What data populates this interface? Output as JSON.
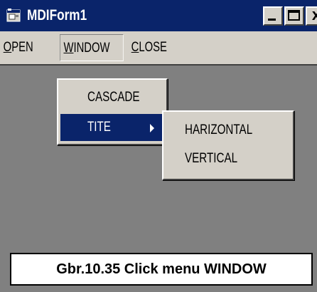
{
  "window": {
    "title": "MDIForm1",
    "icon": "app-form-icon",
    "buttons": {
      "minimize_icon": "minimize-icon",
      "maximize_icon": "maximize-icon",
      "close_label": "x"
    }
  },
  "menubar": {
    "items": [
      {
        "label_underlined": "O",
        "label_rest": "PEN"
      },
      {
        "label_underlined": "W",
        "label_rest": "INDOW"
      },
      {
        "label_underlined": "C",
        "label_rest": "LOSE"
      }
    ]
  },
  "window_menu": {
    "items": [
      {
        "label": "CASCADE",
        "selected": false
      },
      {
        "label": "TITE",
        "selected": true,
        "has_submenu": true
      }
    ]
  },
  "tite_submenu": {
    "items": [
      {
        "label": "HARIZONTAL"
      },
      {
        "label": "VERTICAL"
      }
    ]
  },
  "caption": {
    "text": "Gbr.10.35  Click menu WINDOW"
  },
  "colors": {
    "titlebar": "#0a246a",
    "face": "#d4d0c8",
    "mdi_client": "#808080",
    "highlight": "#0a246a"
  }
}
